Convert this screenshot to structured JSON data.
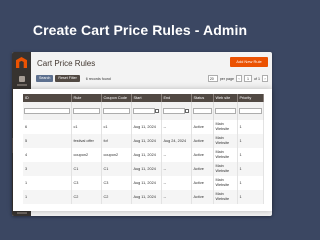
{
  "banner": {
    "title": "Create Cart Price Rules - Admin"
  },
  "page": {
    "title": "Cart Price Rules",
    "add_button": "Add New Rule"
  },
  "toolbar": {
    "search_label": "Search",
    "reset_label": "Reset Filter",
    "records_text": "6 records found",
    "per_page_value": "20",
    "per_page_label": "per page",
    "page_value": "1",
    "of_pages": "of 1"
  },
  "grid": {
    "columns": [
      "ID",
      "Rule",
      "Coupon Code",
      "Start",
      "End",
      "Status",
      "Web site",
      "Priority"
    ],
    "rows": [
      {
        "id": "6",
        "rule": "c1",
        "coupon": "c1",
        "start": "Aug 11, 2024",
        "end": "--",
        "status": "Active",
        "website": "Main Website",
        "priority": "1"
      },
      {
        "id": "5",
        "rule": "festival offer",
        "coupon": "fof",
        "start": "Aug 11, 2024",
        "end": "Aug 24, 2024",
        "status": "Active",
        "website": "Main Website",
        "priority": "1"
      },
      {
        "id": "4",
        "rule": "coupon2",
        "coupon": "coupon2",
        "start": "Aug 11, 2024",
        "end": "--",
        "status": "Active",
        "website": "Main Website",
        "priority": "1"
      },
      {
        "id": "3",
        "rule": "C1",
        "coupon": "C1",
        "start": "Aug 11, 2024",
        "end": "--",
        "status": "Active",
        "website": "Main Website",
        "priority": "1"
      },
      {
        "id": "1",
        "rule": "C3",
        "coupon": "C3",
        "start": "Aug 11, 2024",
        "end": "--",
        "status": "Active",
        "website": "Main Website",
        "priority": "1"
      },
      {
        "id": "1",
        "rule": "C2",
        "coupon": "C2",
        "start": "Aug 11, 2024",
        "end": "--",
        "status": "Active",
        "website": "Main Website",
        "priority": "1"
      }
    ]
  },
  "colors": {
    "background": "#3b4762",
    "sidebar": "#373330",
    "accent": "#eb5202",
    "header": "#514943"
  },
  "sidebar": {
    "icons": [
      "magento-logo-icon",
      "dashboard-icon",
      "sales-icon",
      "catalog-icon",
      "customers-icon",
      "marketing-icon",
      "content-icon",
      "reports-icon",
      "stores-icon",
      "system-icon"
    ]
  }
}
